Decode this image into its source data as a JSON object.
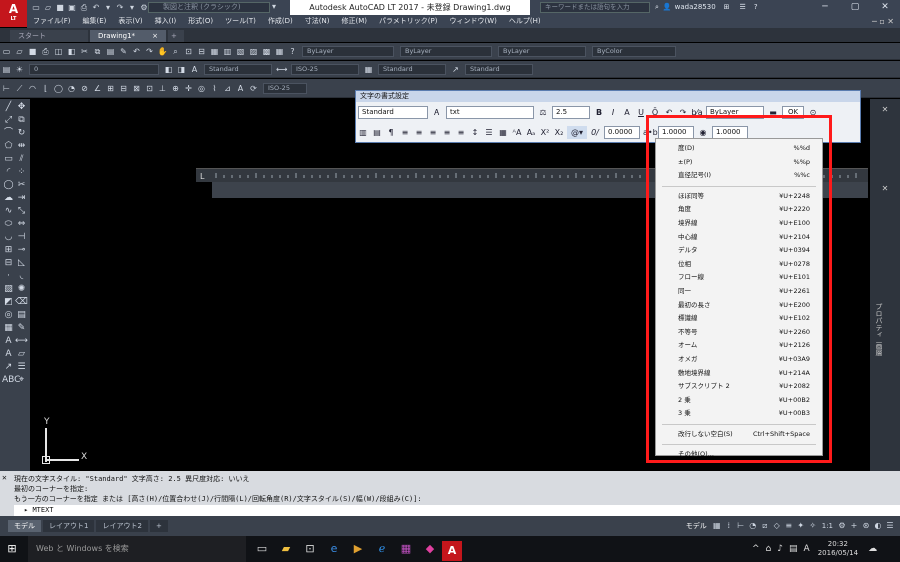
{
  "app": {
    "logo_text": "A",
    "logo_sub": "LT",
    "title": "Autodesk AutoCAD LT 2017 - 未登録   Drawing1.dwg",
    "workspace": "製図と注釈 (クラシック)",
    "search_placeholder": "キーワードまたは語句を入力",
    "user": "wada28530"
  },
  "menu": [
    "ファイル(F)",
    "編集(E)",
    "表示(V)",
    "挿入(I)",
    "形式(O)",
    "ツール(T)",
    "作成(D)",
    "寸法(N)",
    "修正(M)",
    "パラメトリック(P)",
    "ウィンドウ(W)",
    "ヘルプ(H)"
  ],
  "tabs": [
    "スタート",
    "Drawing1*"
  ],
  "properties": {
    "color1": "ByLayer",
    "linetype": "ByLayer",
    "lineweight": "ByLayer",
    "plot": "ByColor",
    "layer": "0",
    "textstyle": "Standard",
    "dimstyle": "ISO-25",
    "tablestyle": "Standard",
    "mleaderstyle": "Standard",
    "dimstyle2": "ISO-25"
  },
  "text_format": {
    "title": "文字の書式設定",
    "style": "Standard",
    "font": "txt",
    "height": "2.5",
    "bold": "B",
    "italic": "I",
    "stack": "A",
    "underline": "U",
    "color": "ByLayer",
    "ok": "OK",
    "oblique": "0.0000",
    "tracking": "1.0000",
    "width": "1.0000"
  },
  "symbols": [
    {
      "label": "度(D)",
      "code": "%%d"
    },
    {
      "label": "±(P)",
      "code": "%%p"
    },
    {
      "label": "直径記号(I)",
      "code": "%%c"
    },
    {
      "sep": true
    },
    {
      "label": "ほぼ同等",
      "code": "¥U+2248"
    },
    {
      "label": "角度",
      "code": "¥U+2220"
    },
    {
      "label": "境界線",
      "code": "¥U+E100"
    },
    {
      "label": "中心線",
      "code": "¥U+2104"
    },
    {
      "label": "デルタ",
      "code": "¥U+0394"
    },
    {
      "label": "位相",
      "code": "¥U+0278"
    },
    {
      "label": "フロー線",
      "code": "¥U+E101"
    },
    {
      "label": "同一",
      "code": "¥U+2261"
    },
    {
      "label": "最初の長さ",
      "code": "¥U+E200"
    },
    {
      "label": "標識線",
      "code": "¥U+E102"
    },
    {
      "label": "不等号",
      "code": "¥U+2260"
    },
    {
      "label": "オーム",
      "code": "¥U+2126"
    },
    {
      "label": "オメガ",
      "code": "¥U+03A9"
    },
    {
      "label": "敷地境界線",
      "code": "¥U+214A"
    },
    {
      "label": "サブスクリプト 2",
      "code": "¥U+2082"
    },
    {
      "label": "2 乗",
      "code": "¥U+00B2"
    },
    {
      "label": "3 乗",
      "code": "¥U+00B3"
    },
    {
      "sep": true
    },
    {
      "label": "改行しない空白(S)",
      "code": "Ctrl+Shift+Space"
    },
    {
      "sep": true
    },
    {
      "label": "その他(O)...",
      "code": ""
    }
  ],
  "ucs": {
    "y": "Y",
    "x": "X"
  },
  "command": {
    "line1": "現在の文字スタイル:  \"Standard\"  文字高さ:  2.5  異尺度対応:  いいえ",
    "line2": "最初のコーナーを指定:",
    "line3": "もう一方のコーナーを指定 または [高さ(H)/位置合わせ(J)/行間隔(L)/回転角度(R)/文字スタイル(S)/幅(W)/段組み(C)]:",
    "input": "MTEXT"
  },
  "layout_tabs": [
    "モデル",
    "レイアウト1",
    "レイアウト2"
  ],
  "status": {
    "model": "モデル",
    "scale": "1:1"
  },
  "right_palette": {
    "label1": "プロパティ",
    "label2": "画層"
  },
  "taskbar": {
    "search": "Web と Windows を検索",
    "time": "20:32",
    "date": "2016/05/14",
    "ime": "A"
  },
  "colors": {
    "accent_red": "#ff1a1a",
    "dark_ui": "#3a414c",
    "dialog_title": "#c9d6ea"
  }
}
